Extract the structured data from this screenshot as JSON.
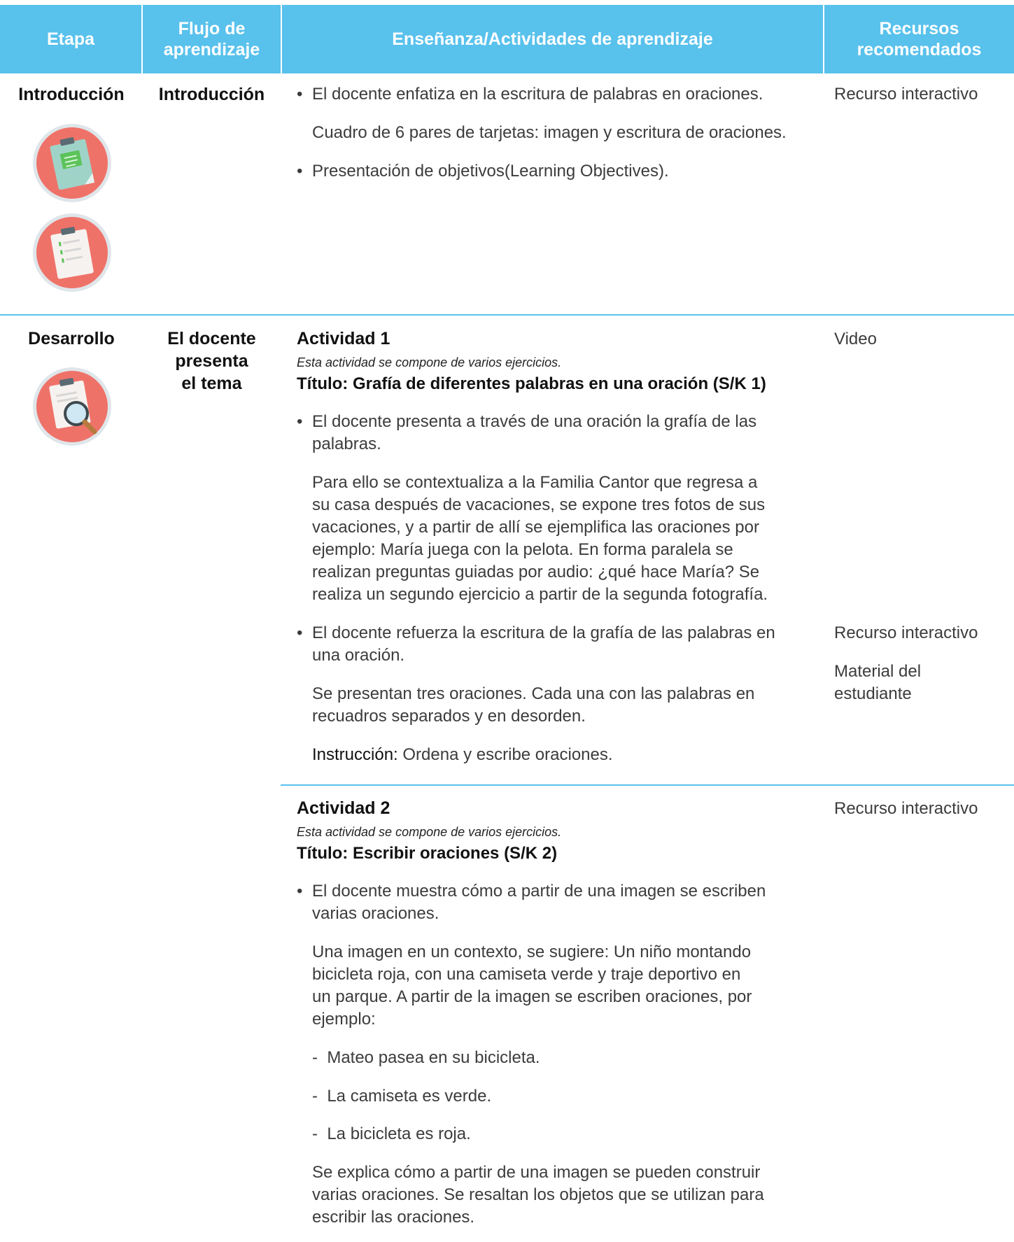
{
  "header": {
    "etapa": "Etapa",
    "flujo": "Flujo de aprendizaje",
    "ensenanza": "Enseñanza/Actividades de aprendizaje",
    "recursos": "Recursos recomendados"
  },
  "intro": {
    "stage": "Introducción",
    "flow": "Introducción",
    "bullet1": "El docente enfatiza en la escritura de palabras en oraciones.",
    "para1": "Cuadro de 6 pares de tarjetas: imagen y escritura de oraciones.",
    "bullet2": "Presentación de objetivos(Learning Objectives).",
    "resource": "Recurso interactivo"
  },
  "desarrollo": {
    "stage": "Desarrollo",
    "flow": [
      "El docente",
      "presenta",
      "el tema"
    ],
    "act1": {
      "title": "Actividad 1",
      "note": "Esta actividad se compone de varios ejercicios.",
      "subtitle": "Título: Grafía de diferentes palabras en una oración (S/K 1)",
      "bullet1": [
        "El docente presenta a través de una oración la grafía de las",
        "palabras."
      ],
      "para1": [
        "Para ello se contextualiza a la Familia Cantor que regresa a",
        "su casa después de vacaciones, se expone tres fotos de sus",
        "vacaciones, y a partir de allí se ejemplifica las oraciones por",
        "ejemplo: María juega con la pelota. En forma paralela se",
        "realizan preguntas guiadas por audio: ¿qué hace María? Se",
        "realiza un segundo ejercicio a partir de la segunda fotografía."
      ],
      "bullet2": [
        "El docente refuerza la escritura de la grafía de las palabras en",
        "una oración."
      ],
      "para2": [
        "Se presentan tres oraciones. Cada una con las palabras en",
        "recuadros separados y en desorden."
      ],
      "instr_label": "Instrucción:",
      "instr_text": " Ordena y escribe oraciones.",
      "resource1": "Video",
      "resource2": "Recurso interactivo",
      "resource3": [
        "Material del",
        "estudiante"
      ]
    },
    "act2": {
      "title": "Actividad 2",
      "note": "Esta actividad se compone de varios ejercicios.",
      "subtitle": "Título: Escribir oraciones (S/K 2)",
      "bullet1": [
        "El docente muestra cómo a partir de una imagen se escriben",
        "varias oraciones."
      ],
      "para1": [
        "Una imagen en un contexto, se sugiere: Un niño montando",
        "bicicleta roja, con una camiseta verde y traje deportivo en",
        "un parque. A partir de la imagen se escriben oraciones, por",
        "ejemplo:"
      ],
      "items": [
        "Mateo pasea en su bicicleta.",
        "La camiseta es verde.",
        "La bicicleta es roja."
      ],
      "para2": [
        "Se explica cómo a partir de una imagen se pueden construir",
        "varias oraciones. Se resaltan los objetos que se utilizan para",
        "escribir las oraciones."
      ],
      "resource": "Recurso interactivo"
    }
  },
  "icons": [
    "clipboard-green-icon",
    "clipboard-checklist-icon",
    "clipboard-magnifier-icon"
  ]
}
